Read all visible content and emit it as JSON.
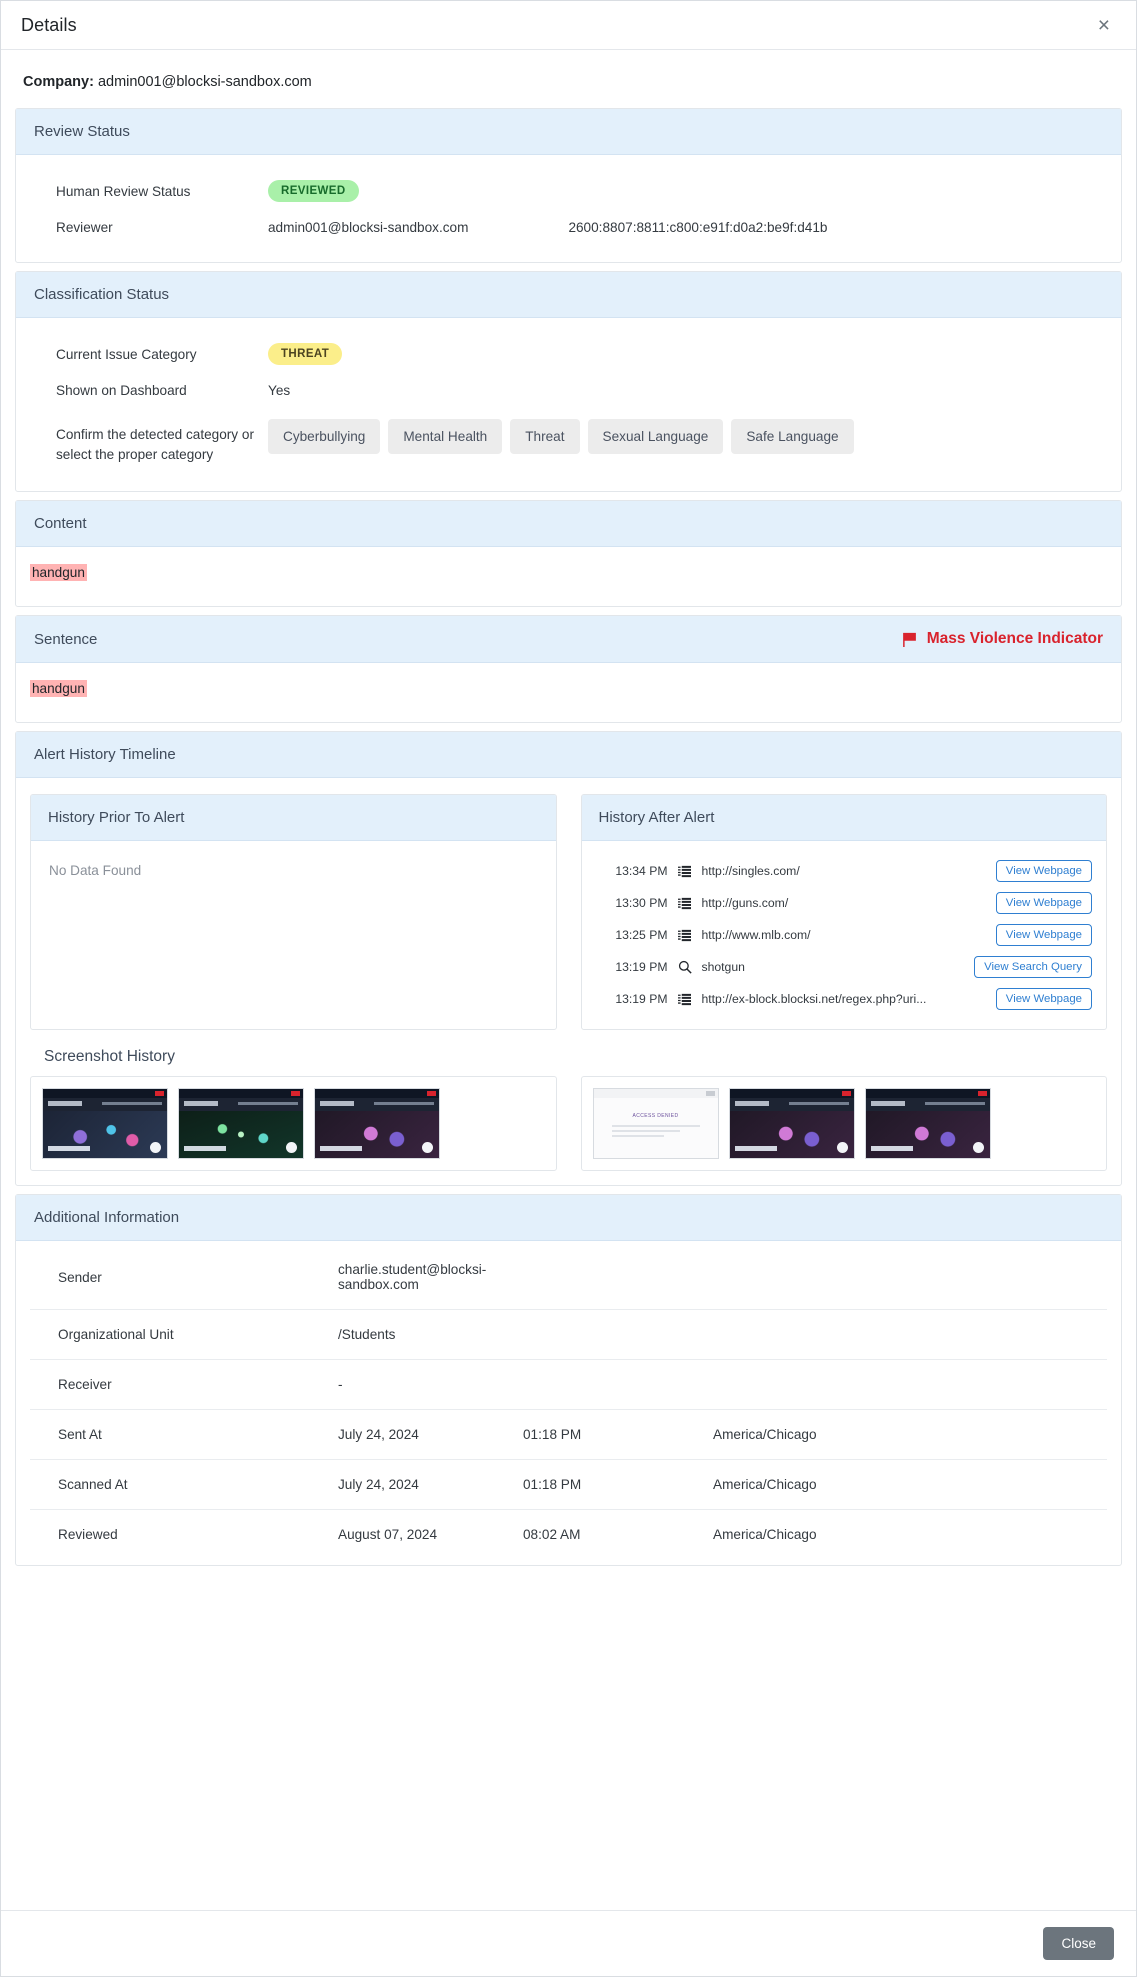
{
  "modal": {
    "title": "Details",
    "close_icon": "close-icon",
    "close_button_label": "Close"
  },
  "company": {
    "label": "Company:",
    "value": "admin001@blocksi-sandbox.com"
  },
  "review_status": {
    "heading": "Review Status",
    "rows": [
      {
        "label": "Human Review Status",
        "badge": "REVIEWED",
        "badge_color": "#a9f0a9",
        "badge_text_color": "#176b2b"
      },
      {
        "label": "Reviewer",
        "value": "admin001@blocksi-sandbox.com",
        "ip": "2600:8807:8811:c800:e91f:d0a2:be9f:d41b"
      }
    ]
  },
  "classification_status": {
    "heading": "Classification Status",
    "current_issue_category_label": "Current Issue Category",
    "current_issue_category_badge": "THREAT",
    "badge_color": "#fbee8a",
    "shown_on_dashboard_label": "Shown on Dashboard",
    "shown_on_dashboard_value": "Yes",
    "confirm_label": "Confirm the detected category or select the proper category",
    "categories": [
      "Cyberbullying",
      "Mental Health",
      "Threat",
      "Sexual Language",
      "Safe Language"
    ]
  },
  "content": {
    "heading": "Content",
    "highlighted_text": "handgun"
  },
  "sentence": {
    "heading": "Sentence",
    "indicator_label": "Mass Violence Indicator",
    "indicator_color": "#d9232d",
    "indicator_icon": "flag-icon",
    "highlighted_text": "handgun"
  },
  "alert_history": {
    "heading": "Alert History Timeline",
    "prior": {
      "heading": "History Prior To Alert",
      "empty_text": "No Data Found",
      "rows": []
    },
    "after": {
      "heading": "History After Alert",
      "rows": [
        {
          "time": "13:34 PM",
          "icon": "webpage-icon",
          "text": "http://singles.com/",
          "button": "View Webpage"
        },
        {
          "time": "13:30 PM",
          "icon": "webpage-icon",
          "text": "http://guns.com/",
          "button": "View Webpage"
        },
        {
          "time": "13:25 PM",
          "icon": "webpage-icon",
          "text": "http://www.mlb.com/",
          "button": "View Webpage"
        },
        {
          "time": "13:19 PM",
          "icon": "search-icon",
          "text": "shotgun",
          "button": "View Search Query"
        },
        {
          "time": "13:19 PM",
          "icon": "webpage-icon",
          "text": "http://ex-block.blocksi.net/regex.php?uri...",
          "button": "View Webpage"
        }
      ]
    },
    "screenshot_history_title": "Screenshot History",
    "screenshots_left": [
      {
        "style": "art-a"
      },
      {
        "style": "art-b"
      },
      {
        "style": "art-c"
      }
    ],
    "screenshots_right": [
      {
        "style": "denied",
        "label": "ACCESS DENIED"
      },
      {
        "style": "art-c"
      },
      {
        "style": "art-c"
      }
    ]
  },
  "additional_information": {
    "heading": "Additional Information",
    "rows": [
      {
        "label": "Sender",
        "v1": "charlie.student@blocksi-sandbox.com",
        "v2": "",
        "v3": ""
      },
      {
        "label": "Organizational Unit",
        "v1": "/Students",
        "v2": "",
        "v3": ""
      },
      {
        "label": "Receiver",
        "v1": "-",
        "v2": "",
        "v3": ""
      },
      {
        "label": "Sent At",
        "v1": "July 24, 2024",
        "v2": "01:18 PM",
        "v3": "America/Chicago"
      },
      {
        "label": "Scanned At",
        "v1": "July 24, 2024",
        "v2": "01:18 PM",
        "v3": "America/Chicago"
      },
      {
        "label": "Reviewed",
        "v1": "August 07, 2024",
        "v2": "08:02 AM",
        "v3": "America/Chicago"
      }
    ]
  }
}
